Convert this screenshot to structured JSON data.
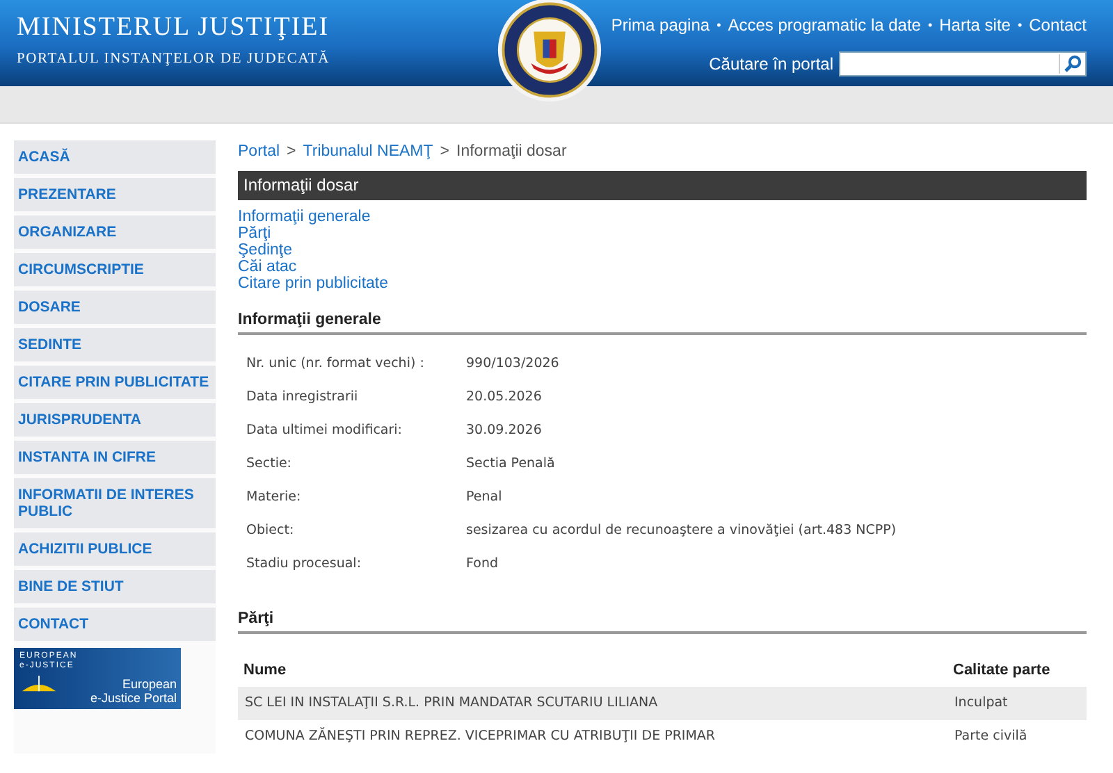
{
  "header": {
    "title": "MINISTERUL JUSTIŢIEI",
    "subtitle": "PORTALUL INSTANŢELOR DE JUDECATĂ",
    "top_links": [
      "Prima pagina",
      "Acces programatic la date",
      "Harta site",
      "Contact"
    ],
    "top_links_separator": "•",
    "search": {
      "label": "Căutare în portal"
    }
  },
  "sidebar": {
    "items": [
      {
        "label": "ACASĂ"
      },
      {
        "label": "PREZENTARE"
      },
      {
        "label": "ORGANIZARE"
      },
      {
        "label": "CIRCUMSCRIPTIE"
      },
      {
        "label": "DOSARE"
      },
      {
        "label": "SEDINTE"
      },
      {
        "label": "CITARE PRIN PUBLICITATE"
      },
      {
        "label": "JURISPRUDENTA"
      },
      {
        "label": "INSTANTA IN CIFRE"
      },
      {
        "label": "INFORMATII DE INTERES PUBLIC"
      },
      {
        "label": "ACHIZITII PUBLICE"
      },
      {
        "label": "BINE DE STIUT"
      },
      {
        "label": "CONTACT"
      }
    ],
    "banner": {
      "line_1": "EUROPEAN",
      "line_2": "e-JUSTICE",
      "caption_1": "European",
      "caption_2": "e-Justice Portal"
    }
  },
  "breadcrumb_separator": ">",
  "breadcrumb": [
    {
      "label": "Portal",
      "link": true
    },
    {
      "label": "Tribunalul NEAMŢ",
      "link": true
    },
    {
      "label": "Informaţii dosar",
      "link": false
    }
  ],
  "page_title": "Informaţii dosar",
  "section_links": [
    "Informaţii generale",
    "Părţi",
    "Şedinţe",
    "Căi atac",
    "Citare prin publicitate"
  ],
  "general": {
    "heading": "Informaţii generale",
    "fields": [
      {
        "label": "Nr. unic (nr. format vechi) :",
        "value": "990/103/2026"
      },
      {
        "label": "Data inregistrarii",
        "value": "20.05.2026"
      },
      {
        "label": "Data ultimei modificari:",
        "value": "30.09.2026"
      },
      {
        "label": "Sectie:",
        "value": "Sectia Penală"
      },
      {
        "label": "Materie:",
        "value": "Penal"
      },
      {
        "label": "Obiect:",
        "value": "sesizarea cu acordul de recunoaştere a vinovăţiei (art.483 NCPP)"
      },
      {
        "label": "Stadiu procesual:",
        "value": "Fond"
      }
    ]
  },
  "parties": {
    "heading": "Părţi",
    "columns": [
      "Nume",
      "Calitate parte"
    ],
    "rows": [
      {
        "name": "SC LEI IN INSTALAŢII S.R.L. PRIN MANDATAR SCUTARIU LILIANA",
        "role": "Inculpat"
      },
      {
        "name": "COMUNA ZĂNEŞTI PRIN REPREZ. VICEPRIMAR CU ATRIBUŢII DE PRIMAR",
        "role": "Parte civilă"
      }
    ]
  }
}
